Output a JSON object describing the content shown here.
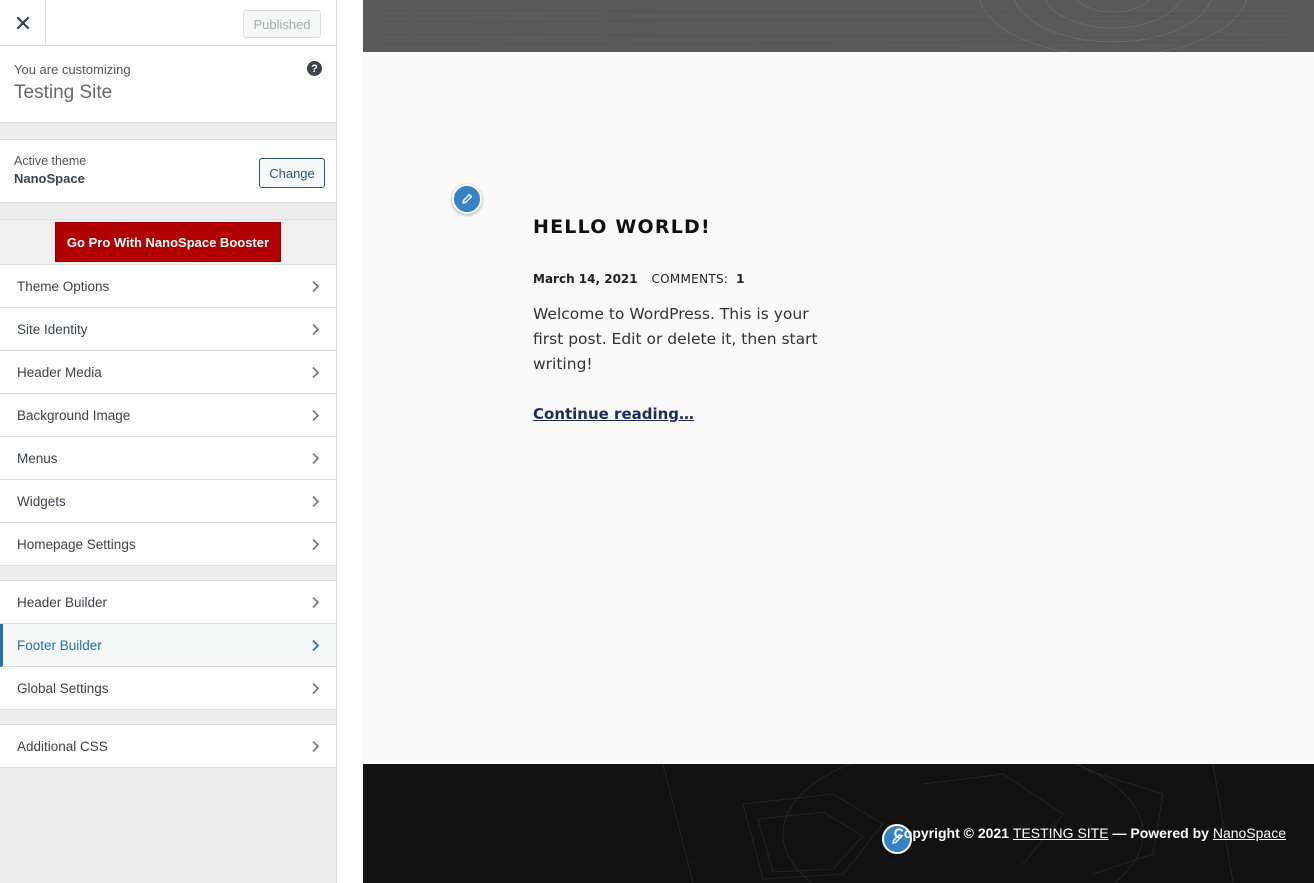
{
  "sidebar": {
    "publish_label": "Published",
    "customizing_label": "You are customizing",
    "site_title": "Testing Site",
    "active_theme_label": "Active theme",
    "theme_name": "NanoSpace",
    "change_label": "Change",
    "promo_label": "Go Pro With NanoSpace Booster",
    "sections_a": [
      {
        "label": "Theme Options"
      },
      {
        "label": "Site Identity"
      },
      {
        "label": "Header Media"
      },
      {
        "label": "Background Image"
      },
      {
        "label": "Menus"
      },
      {
        "label": "Widgets"
      },
      {
        "label": "Homepage Settings"
      }
    ],
    "sections_b": [
      {
        "label": "Header Builder"
      },
      {
        "label": "Footer Builder",
        "active": true
      },
      {
        "label": "Global Settings"
      }
    ],
    "sections_c": [
      {
        "label": "Additional CSS"
      }
    ],
    "accent_color": "#2271b1"
  },
  "preview": {
    "post": {
      "title": "HELLO WORLD!",
      "date": "March 14, 2021",
      "comments_label": "COMMENTS:",
      "comments_count": "1",
      "excerpt": "Welcome to WordPress. This is your first post. Edit or delete it, then start writing!",
      "continue_label": "Continue reading…"
    },
    "footer": {
      "copyright_prefix": "Copyright © 2021",
      "site_link": "TESTING SITE",
      "powered_by": "— Powered by",
      "theme_link": "NanoSpace"
    },
    "promo_color": "#b00000",
    "shortcut_color": "#3582c4"
  }
}
